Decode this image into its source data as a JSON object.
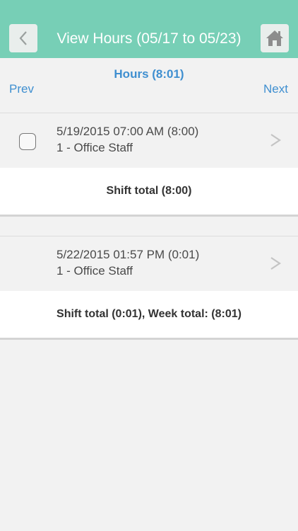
{
  "header": {
    "title": "View Hours (05/17 to 05/23)",
    "back_icon": "chevron-left-icon",
    "home_icon": "home-icon"
  },
  "nav": {
    "hours_title": "Hours (8:01)",
    "prev_label": "Prev",
    "next_label": "Next"
  },
  "shifts": [
    {
      "line1": "5/19/2015 07:00 AM (8:00)",
      "line2": "1 - Office Staff",
      "has_checkbox": true,
      "total": "Shift total (8:00)"
    },
    {
      "line1": "5/22/2015 01:57 PM (0:01)",
      "line2": "1 - Office Staff",
      "has_checkbox": false,
      "total": "Shift total (0:01), Week total: (8:01)"
    }
  ],
  "colors": {
    "header_bg": "#77cfb6",
    "link": "#3f8fd0",
    "background": "#f2f2f2"
  }
}
